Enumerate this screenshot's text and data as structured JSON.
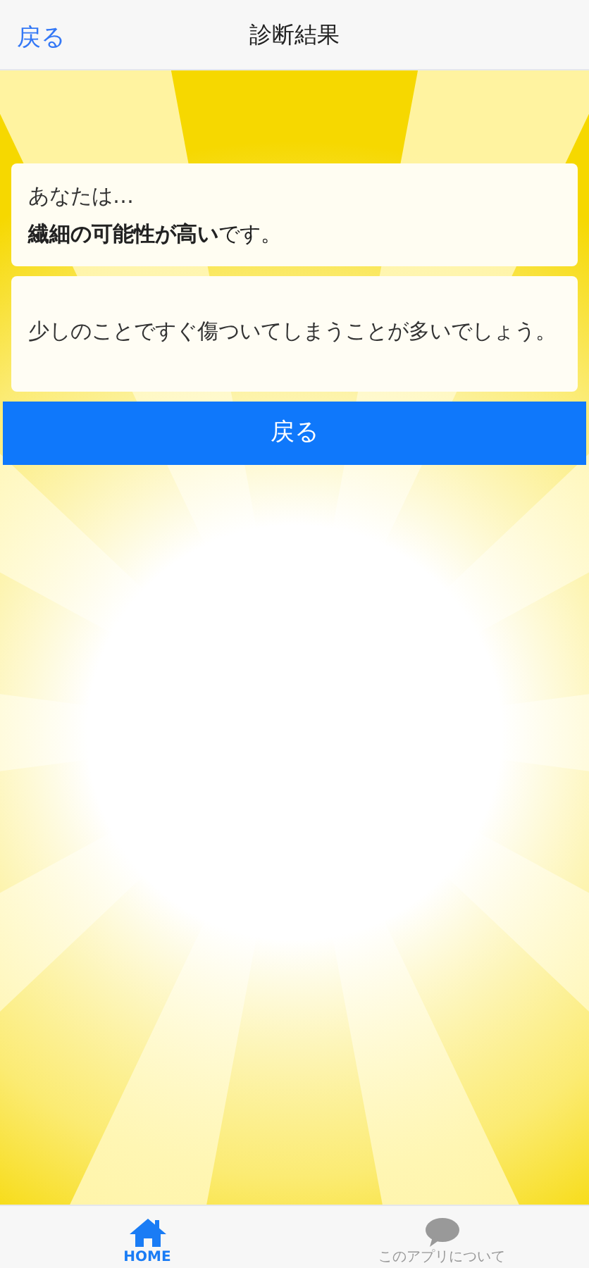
{
  "header": {
    "back_label": "戻る",
    "title": "診断結果"
  },
  "result": {
    "intro": "あなたは…",
    "headline": "**繊細の可能性が高い**です。",
    "description": "少しのことですぐ傷ついてしまうことが多いでしょう。"
  },
  "back_button": {
    "label": "戻る"
  },
  "tabs": [
    {
      "kind": "home",
      "label": "HOME",
      "selected": true
    },
    {
      "kind": "chat",
      "label": "このアプリについて",
      "selected": false
    }
  ]
}
